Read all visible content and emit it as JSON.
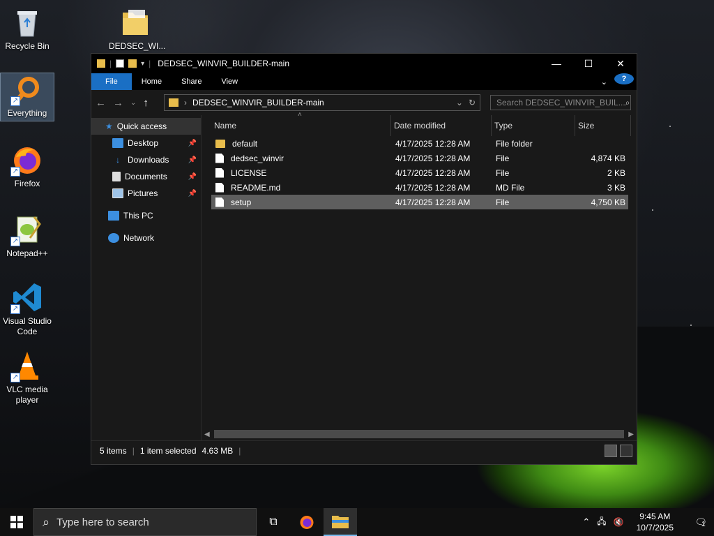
{
  "desktop": {
    "icons": [
      {
        "label": "Recycle Bin"
      },
      {
        "label": "DEDSEC_WI..."
      },
      {
        "label": "Everything"
      },
      {
        "label": "Firefox"
      },
      {
        "label": "Notepad++"
      },
      {
        "label": "Visual Studio Code"
      },
      {
        "label": "VLC media player"
      }
    ]
  },
  "explorer": {
    "title": "DEDSEC_WINVIR_BUILDER-main",
    "ribbon_tabs": [
      "File",
      "Home",
      "Share",
      "View"
    ],
    "address": "DEDSEC_WINVIR_BUILDER-main",
    "search_placeholder": "Search DEDSEC_WINVIR_BUIL...",
    "nav_pane": [
      {
        "label": "Quick access"
      },
      {
        "label": "Desktop"
      },
      {
        "label": "Downloads"
      },
      {
        "label": "Documents"
      },
      {
        "label": "Pictures"
      },
      {
        "label": "This PC"
      },
      {
        "label": "Network"
      }
    ],
    "columns": [
      "Name",
      "Date modified",
      "Type",
      "Size"
    ],
    "files": [
      {
        "name": "default",
        "date": "4/17/2025 12:28 AM",
        "type": "File folder",
        "size": ""
      },
      {
        "name": "dedsec_winvir",
        "date": "4/17/2025 12:28 AM",
        "type": "File",
        "size": "4,874 KB"
      },
      {
        "name": "LICENSE",
        "date": "4/17/2025 12:28 AM",
        "type": "File",
        "size": "2 KB"
      },
      {
        "name": "README.md",
        "date": "4/17/2025 12:28 AM",
        "type": "MD File",
        "size": "3 KB"
      },
      {
        "name": "setup",
        "date": "4/17/2025 12:28 AM",
        "type": "File",
        "size": "4,750 KB"
      }
    ],
    "status": {
      "items": "5 items",
      "selected": "1 item selected",
      "size": "4.63 MB"
    }
  },
  "taskbar": {
    "search_placeholder": "Type here to search",
    "time": "9:45 AM",
    "date": "10/7/2025",
    "notification_count": "1"
  },
  "colors": {
    "accent": "#1a6fc4",
    "folder": "#e8bd4c",
    "selection": "#5e5e5e"
  }
}
